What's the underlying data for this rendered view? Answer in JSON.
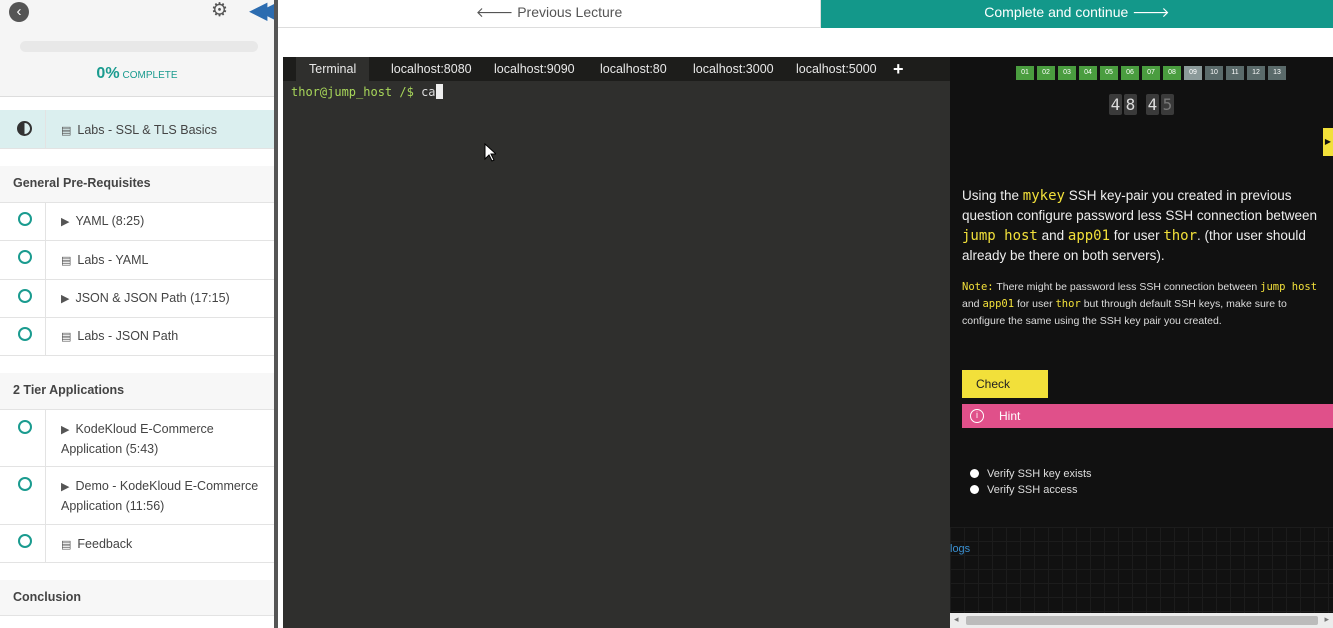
{
  "sidebar": {
    "progress_pct": "0%",
    "progress_word": "COMPLETE",
    "progress_value": 0,
    "items": [
      {
        "label": "Labs - SSL & TLS Basics",
        "type": "doc",
        "state": "half"
      },
      {
        "section": "General Pre-Requisites"
      },
      {
        "label": "YAML (8:25)",
        "type": "video"
      },
      {
        "label": "Labs - YAML",
        "type": "doc"
      },
      {
        "label": "JSON & JSON Path (17:15)",
        "type": "video"
      },
      {
        "label": "Labs - JSON Path",
        "type": "doc"
      },
      {
        "section": "2 Tier Applications"
      },
      {
        "label": "KodeKloud E-Commerce Application (5:43)",
        "type": "video"
      },
      {
        "label": "Demo - KodeKloud E-Commerce Application (11:56)",
        "type": "video"
      },
      {
        "label": "Feedback",
        "type": "doc"
      },
      {
        "section": "Conclusion"
      }
    ]
  },
  "topnav": {
    "prev_label": "Previous Lecture",
    "next_label": "Complete and continue"
  },
  "terminal": {
    "tabs": [
      "Terminal",
      "localhost:8080",
      "localhost:9090",
      "localhost:80",
      "localhost:3000",
      "localhost:5000"
    ],
    "add_label": "+",
    "prompt": "thor@jump_host /$",
    "command": "ca"
  },
  "question_panel": {
    "question_numbers": [
      "01",
      "02",
      "03",
      "04",
      "05",
      "06",
      "07",
      "08",
      "09",
      "10",
      "11",
      "12",
      "13"
    ],
    "current_index": 8,
    "timer_digits": [
      "4",
      "8",
      "4",
      "5"
    ],
    "q_text": {
      "p1": "Using the ",
      "h1": "mykey",
      "p2": " SSH key-pair you created in previous question configure password less SSH connection between ",
      "h2": "jump host",
      "p3": " and ",
      "h3": "app01",
      "p4": " for user ",
      "h4": "thor",
      "p5": ". (thor user should already be there on both servers)."
    },
    "note": {
      "label": "Note:",
      "p1": " There might be password less SSH connection between ",
      "h1": "jump host",
      "p2": " and ",
      "h2": "app01",
      "p3": " for user ",
      "h3": "thor",
      "p4": " but through default SSH keys, make sure to configure the same using the SSH key pair you created."
    },
    "check_label": "Check",
    "hint_label": "Hint",
    "tasks": [
      "Verify SSH key exists",
      "Verify SSH access"
    ],
    "logs_label": "logs"
  },
  "colors": {
    "accent_teal": "#13988a",
    "highlight_yellow": "#f2e03a",
    "hint_pink": "#e0508a",
    "done_green": "#4a9d3f"
  }
}
